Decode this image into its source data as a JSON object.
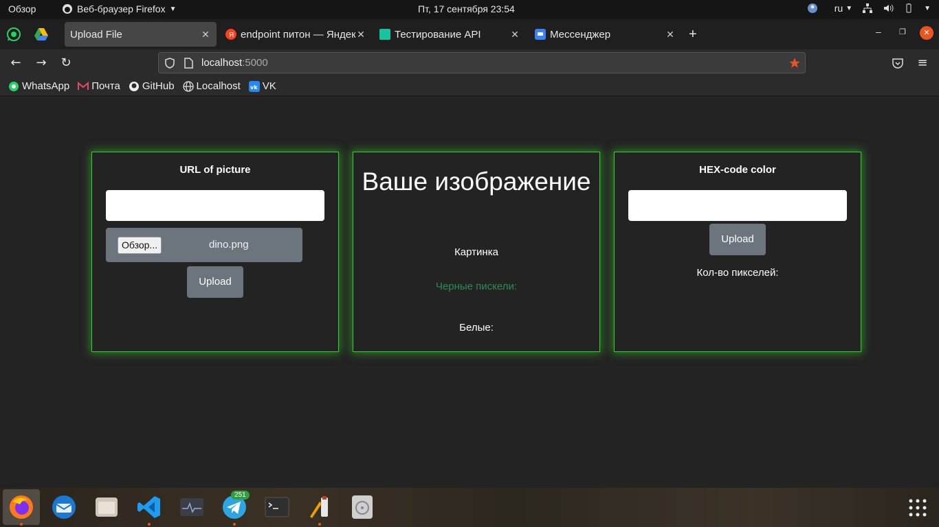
{
  "system": {
    "activities": "Обзор",
    "app_menu": "Веб-браузер Firefox",
    "clock": "Пт, 17 сентября  23:54",
    "keyboard_layout": "ru"
  },
  "browser": {
    "tabs": [
      {
        "label": "Upload File",
        "active": true
      },
      {
        "label": "endpoint питон — Яндекс",
        "active": false
      },
      {
        "label": "Тестирование API",
        "active": false
      },
      {
        "label": "Мессенджер",
        "active": false
      }
    ],
    "url": {
      "host": "localhost",
      "port": ":5000"
    },
    "bookmarks": [
      {
        "label": "WhatsApp",
        "icon": "whatsapp-icon"
      },
      {
        "label": "Почта",
        "icon": "mail-icon"
      },
      {
        "label": "GitHub",
        "icon": "github-icon"
      },
      {
        "label": "Localhost",
        "icon": "globe-icon"
      },
      {
        "label": "VK",
        "icon": "vk-icon"
      }
    ],
    "accent_color": "#e95420"
  },
  "page": {
    "left_card": {
      "title": "URL of picture",
      "url_value": "",
      "browse_label": "Обзор...",
      "file_name": "dino.png",
      "upload_label": "Upload"
    },
    "center_card": {
      "title": "Ваше изображение",
      "picture_label": "Картинка",
      "black_pixels_label": "Черные пискели:",
      "white_label": "Белые:"
    },
    "right_card": {
      "title": "HEX-code color",
      "hex_value": "",
      "upload_label": "Upload",
      "pixel_count_label": "Кол-во пикселей:"
    },
    "colors": {
      "card_border": "#2fd22f",
      "button_bg": "#6c757d",
      "black_pixels_text": "#2e8b57"
    }
  },
  "dock": {
    "telegram_badge": "251"
  }
}
